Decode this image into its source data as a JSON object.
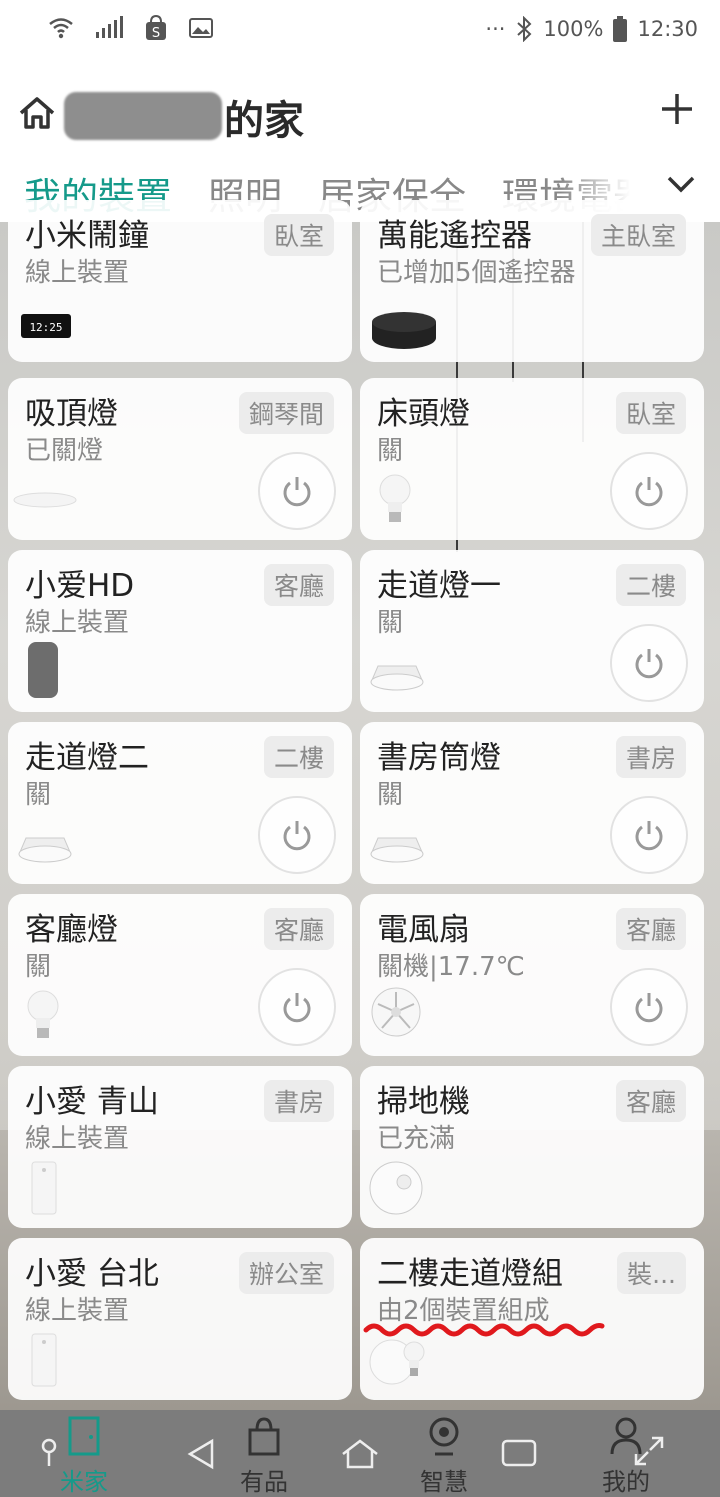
{
  "status_bar": {
    "icons_left": [
      "wifi-icon",
      "signal-icon",
      "shopee-icon",
      "image-icon"
    ],
    "dots": "···",
    "battery": "100%",
    "time": "12:30"
  },
  "header": {
    "home_title": "的家",
    "add_icon": "plus-icon"
  },
  "tabs": [
    {
      "label": "我的裝置",
      "active": true
    },
    {
      "label": "照明",
      "active": false
    },
    {
      "label": "居家保全",
      "active": false
    },
    {
      "label": "環境電器",
      "active": false
    }
  ],
  "devices": [
    {
      "name": "小米鬧鐘",
      "status": "線上裝置",
      "room": "臥室",
      "image": "clock",
      "power": false
    },
    {
      "name": "萬能遙控器",
      "status": "已增加5個遙控器",
      "room": "主臥室",
      "image": "remote",
      "power": false
    },
    {
      "name": "吸頂燈",
      "status": "已關燈",
      "room": "鋼琴間",
      "image": "ceiling-light",
      "power": true
    },
    {
      "name": "床頭燈",
      "status": "關",
      "room": "臥室",
      "image": "bulb",
      "power": true
    },
    {
      "name": "小爱HD",
      "status": "線上裝置",
      "room": "客廳",
      "image": "speaker-gray",
      "power": false
    },
    {
      "name": "走道燈一",
      "status": "關",
      "room": "二樓",
      "image": "downlight",
      "power": true
    },
    {
      "name": "走道燈二",
      "status": "關",
      "room": "二樓",
      "image": "downlight",
      "power": true
    },
    {
      "name": "書房筒燈",
      "status": "關",
      "room": "書房",
      "image": "downlight",
      "power": true
    },
    {
      "name": "客廳燈",
      "status": "關",
      "room": "客廳",
      "image": "bulb",
      "power": true
    },
    {
      "name": "電風扇",
      "status": "關機|17.7℃",
      "room": "客廳",
      "image": "fan",
      "power": true
    },
    {
      "name": "小愛 青山",
      "status": "線上裝置",
      "room": "書房",
      "image": "speaker-white",
      "power": false
    },
    {
      "name": "掃地機",
      "status": "已充滿",
      "room": "客廳",
      "image": "vacuum",
      "power": false
    },
    {
      "name": "小愛 台北",
      "status": "線上裝置",
      "room": "辦公室",
      "image": "speaker-white",
      "power": false
    },
    {
      "name": "二樓走道燈組",
      "status": "由2個裝置組成",
      "room": "裝...",
      "image": "group",
      "power": false
    }
  ],
  "bottom_nav": {
    "items": [
      {
        "label": "米家",
        "icon": "door-icon",
        "active": true
      },
      {
        "label": "有品",
        "icon": "bag-icon",
        "active": false
      },
      {
        "label": "智慧",
        "icon": "camera-icon",
        "active": false
      },
      {
        "label": "我的",
        "icon": "user-icon",
        "active": false
      }
    ]
  },
  "colors": {
    "accent": "#159a8a",
    "annotation": "#e0191d"
  }
}
